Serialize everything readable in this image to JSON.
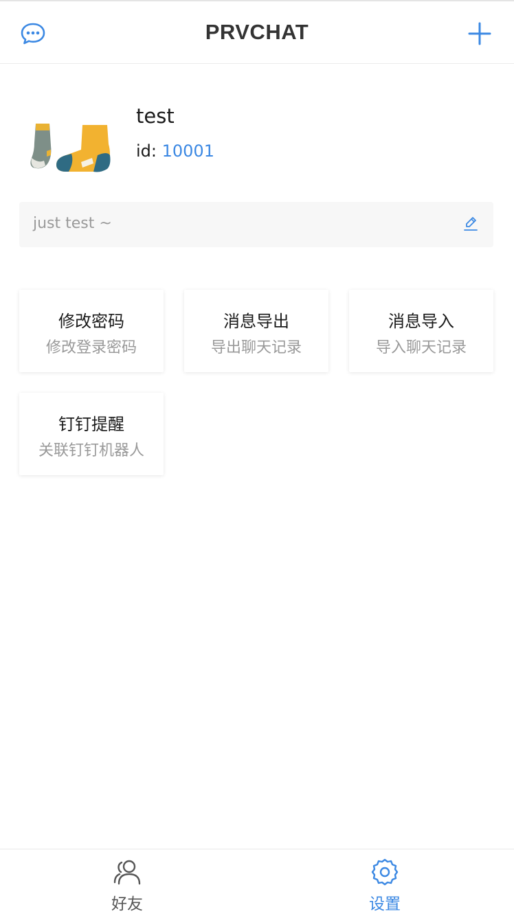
{
  "header": {
    "title": "PRVCHAT",
    "left_icon": "chat-bubble-icon",
    "right_icon": "plus-icon",
    "accent_color": "#3b88e3"
  },
  "profile": {
    "name": "test",
    "id_label": "id: ",
    "id_value": "10001",
    "avatar": "socks-avatar-image"
  },
  "signature": {
    "text": "just test ~",
    "icon": "edit-pencil-icon"
  },
  "cards": [
    {
      "title": "修改密码",
      "subtitle": "修改登录密码"
    },
    {
      "title": "消息导出",
      "subtitle": "导出聊天记录"
    },
    {
      "title": "消息导入",
      "subtitle": "导入聊天记录"
    },
    {
      "title": "钉钉提醒",
      "subtitle": "关联钉钉机器人"
    }
  ],
  "tabbar": {
    "tabs": [
      {
        "label": "好友",
        "icon": "friends-icon",
        "active": false
      },
      {
        "label": "设置",
        "icon": "settings-gear-icon",
        "active": true
      }
    ],
    "active_color": "#3b88e3",
    "inactive_color": "#555555"
  }
}
